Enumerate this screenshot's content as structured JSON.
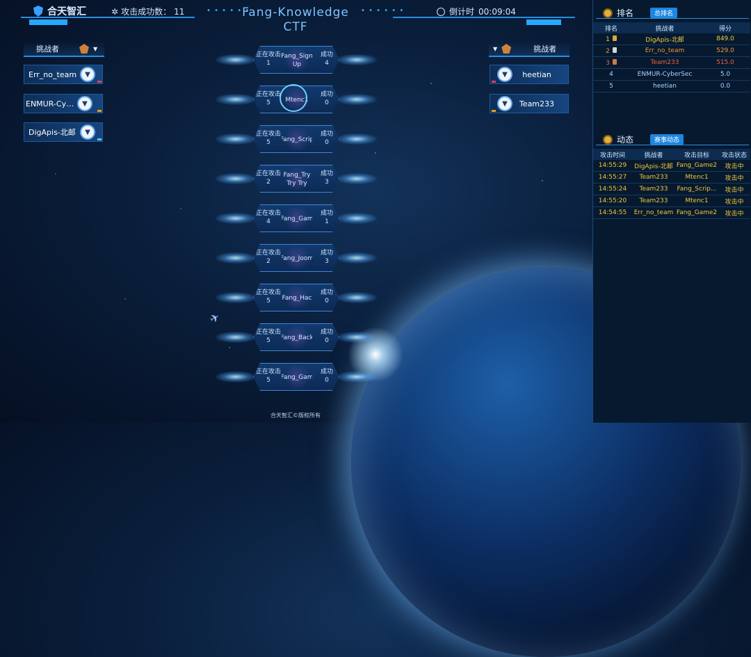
{
  "topbar": {
    "logo": "合天智汇",
    "attack_count_label": "攻击成功数：",
    "attack_count": "11",
    "title_line1": "Fang-Knowledge",
    "title_line2": "CTF",
    "countdown_label": "倒计时",
    "countdown_value": "00:09:04"
  },
  "left": {
    "header": "挑战者",
    "challengers": [
      {
        "name": "Err_no_team",
        "color": "#e0405a"
      },
      {
        "name": "ENMUR-Cybe...",
        "color": "#e0a020"
      },
      {
        "name": "DigApis-北邮",
        "color": "#5cc6e6"
      }
    ]
  },
  "right": {
    "header": "挑战者",
    "challengers": [
      {
        "name": "heetian",
        "color": "#e0405a"
      },
      {
        "name": "Team233",
        "color": "#e0a020"
      }
    ]
  },
  "targets": [
    {
      "attacking_label": "正在攻击",
      "attacking": "1",
      "name": "Fang_Sign Up",
      "success_label": "成功",
      "success": "4"
    },
    {
      "attacking_label": "正在攻击",
      "attacking": "5",
      "name": "Mtenc1",
      "success_label": "成功",
      "success": "0"
    },
    {
      "attacking_label": "正在攻击",
      "attacking": "5",
      "name": "Fang_Scrip",
      "success_label": "成功",
      "success": "0"
    },
    {
      "attacking_label": "正在攻击",
      "attacking": "2",
      "name": "Fang_Try Try Try",
      "success_label": "成功",
      "success": "3"
    },
    {
      "attacking_label": "正在攻击",
      "attacking": "4",
      "name": "Fang_Gam",
      "success_label": "成功",
      "success": "1"
    },
    {
      "attacking_label": "正在攻击",
      "attacking": "2",
      "name": "Fang_Joom",
      "success_label": "成功",
      "success": "3"
    },
    {
      "attacking_label": "正在攻击",
      "attacking": "5",
      "name": "Fang_Hac",
      "success_label": "成功",
      "success": "0"
    },
    {
      "attacking_label": "正在攻击",
      "attacking": "5",
      "name": "Fang_Back",
      "success_label": "成功",
      "success": "0"
    },
    {
      "attacking_label": "正在攻击",
      "attacking": "5",
      "name": "Fang_Gam",
      "success_label": "成功",
      "success": "0"
    }
  ],
  "ranking": {
    "title": "排名",
    "tab": "总排名",
    "headers": [
      "排名",
      "挑战者",
      "得分"
    ],
    "rows": [
      {
        "rank": "1",
        "name": "DigApis-北邮",
        "score": "849.0",
        "color": "#f0d040",
        "icon": "gold-medal-icon"
      },
      {
        "rank": "2",
        "name": "Err_no_team",
        "score": "529.0",
        "color": "#f09a30",
        "icon": "silver-medal-icon"
      },
      {
        "rank": "3",
        "name": "Team233",
        "score": "515.0",
        "color": "#f06040",
        "icon": "bronze-medal-icon"
      },
      {
        "rank": "4",
        "name": "ENMUR-CyberSec",
        "score": "5.0",
        "color": "#a9d6ff"
      },
      {
        "rank": "5",
        "name": "heetian",
        "score": "0.0",
        "color": "#a9d6ff"
      }
    ]
  },
  "activity": {
    "title": "动态",
    "tab": "赛事动态",
    "headers": [
      "攻击时间",
      "挑战者",
      "攻击目标",
      "攻击状态"
    ],
    "rows": [
      {
        "time": "14:55:29",
        "challenger": "DigApis-北邮",
        "target": "Fang_Game2",
        "status": "攻击中"
      },
      {
        "time": "14:55:27",
        "challenger": "Team233",
        "target": "Mtenc1",
        "status": "攻击中"
      },
      {
        "time": "14:55:24",
        "challenger": "Team233",
        "target": "Fang_Scrip...",
        "status": "攻击中"
      },
      {
        "time": "14:55:20",
        "challenger": "Team233",
        "target": "Mtenc1",
        "status": "攻击中"
      },
      {
        "time": "14:54:55",
        "challenger": "Err_no_team",
        "target": "Fang_Game2",
        "status": "攻击中"
      }
    ]
  },
  "footer": "合天智汇©版权所有",
  "colors": {
    "accent": "#2a8fe0",
    "activity_text": "#f0c83a"
  }
}
